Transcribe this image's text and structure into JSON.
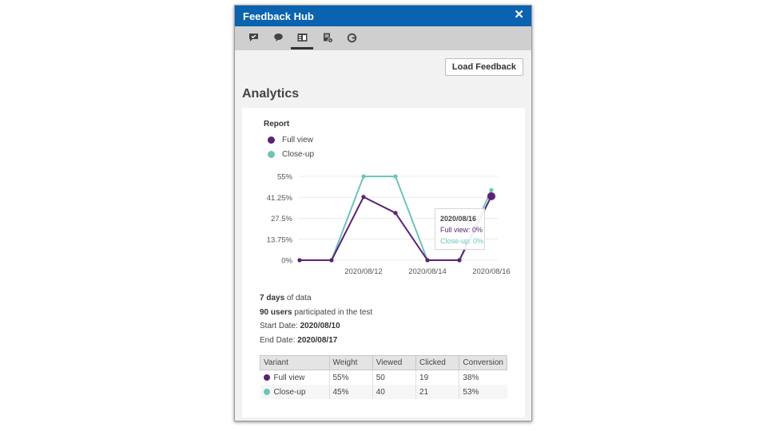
{
  "window": {
    "title": "Feedback Hub",
    "close_glyph": "✕"
  },
  "toolbar": {
    "tools": [
      {
        "name": "feedback-icon"
      },
      {
        "name": "chat-icon"
      },
      {
        "name": "report-icon",
        "active": true
      },
      {
        "name": "document-settings-icon"
      },
      {
        "name": "refresh-icon"
      }
    ]
  },
  "actions": {
    "load_label": "Load Feedback"
  },
  "page": {
    "heading": "Analytics"
  },
  "colors": {
    "full_view": "#5b2277",
    "close_up": "#6cc5b8",
    "titlebar": "#0a63b1"
  },
  "chart_data": {
    "type": "line",
    "title": "Report",
    "x": [
      "2020/08/10",
      "2020/08/11",
      "2020/08/12",
      "2020/08/13",
      "2020/08/14",
      "2020/08/15",
      "2020/08/16",
      "2020/08/17"
    ],
    "x_tick_labels": [
      "2020/08/12",
      "2020/08/14",
      "2020/08/16"
    ],
    "y_tick_labels": [
      "55%",
      "41.25%",
      "27.5%",
      "13.75%",
      "0%"
    ],
    "ylim": [
      0,
      55
    ],
    "grid": true,
    "legend_position": "top-left",
    "series": [
      {
        "name": "Full view",
        "values": [
          0,
          0,
          41.5,
          31,
          0,
          0,
          42
        ]
      },
      {
        "name": "Close-up",
        "values": [
          0,
          0,
          55,
          55,
          0,
          0,
          46
        ]
      }
    ],
    "tooltip": {
      "date": "2020/08/16",
      "full_view": "Full view: 0%",
      "close_up": "Close-up: 0%"
    }
  },
  "summary": {
    "days_bold": "7 days",
    "days_rest": " of data",
    "users_bold": "90 users",
    "users_rest": " participated in the test",
    "start_label": "Start Date: ",
    "start_value": "2020/08/10",
    "end_label": "End Date: ",
    "end_value": "2020/08/17"
  },
  "table": {
    "headers": [
      "Variant",
      "Weight",
      "Viewed",
      "Clicked",
      "Conversion"
    ],
    "rows": [
      {
        "variant": "Full view",
        "weight": "55%",
        "viewed": "50",
        "clicked": "19",
        "conversion": "38%"
      },
      {
        "variant": "Close-up",
        "weight": "45%",
        "viewed": "40",
        "clicked": "21",
        "conversion": "53%"
      }
    ]
  }
}
